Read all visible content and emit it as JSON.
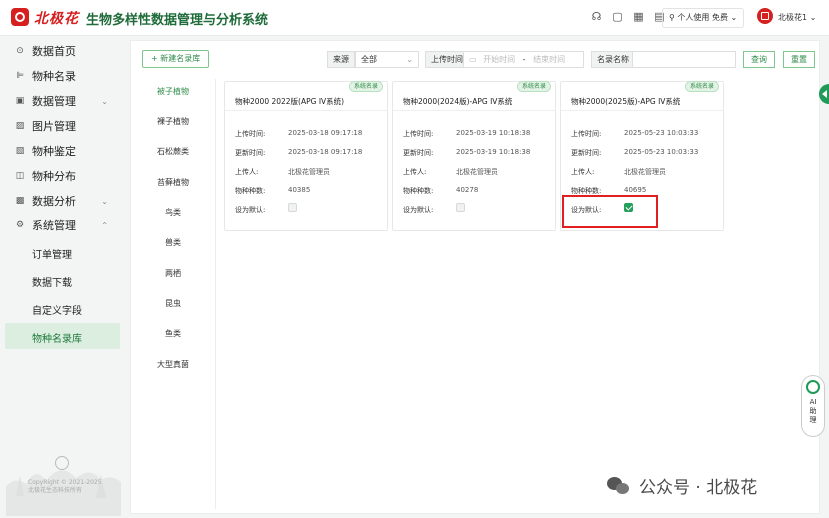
{
  "header": {
    "logo_text": "北极花",
    "app_title": "生物多样性数据管理与分析系统",
    "user_plan": "个人使用 免费",
    "user_name": "北极花1"
  },
  "sidebar": {
    "items": [
      {
        "label": "数据首页",
        "icon": "dashboard-icon"
      },
      {
        "label": "物种名录",
        "icon": "list-icon"
      },
      {
        "label": "数据管理",
        "icon": "folder-icon"
      },
      {
        "label": "图片管理",
        "icon": "image-icon"
      },
      {
        "label": "物种鉴定",
        "icon": "identify-icon"
      },
      {
        "label": "物种分布",
        "icon": "map-icon"
      },
      {
        "label": "数据分析",
        "icon": "chart-icon"
      },
      {
        "label": "系统管理",
        "icon": "settings-icon"
      }
    ],
    "sub_items": [
      "订单管理",
      "数据下载",
      "自定义字段",
      "物种名录库"
    ],
    "copyright": "CopyRight © 2021-2025",
    "copyright2": "北极花生态科技所有"
  },
  "toolbar": {
    "new_button": "+ 新建名录库",
    "source_label": "来源",
    "source_value": "全部",
    "upload_time_label": "上传时间",
    "start_placeholder": "开始时间",
    "end_placeholder": "结束时间",
    "dash": "-",
    "name_label": "名录名称",
    "query_button": "查询",
    "reset_button": "重置"
  },
  "categories": [
    "被子植物",
    "裸子植物",
    "石松蕨类",
    "苔藓植物",
    "鸟类",
    "兽类",
    "两栖",
    "昆虫",
    "鱼类",
    "大型真菌"
  ],
  "card_labels": {
    "upload_time": "上传时间:",
    "update_time": "更新时间:",
    "uploader": "上传人:",
    "species_count": "物种种数:",
    "set_default": "设为默认:"
  },
  "cards": [
    {
      "badge": "系统名录",
      "title": "物种2000 2022版(APG IV系统)",
      "upload_time": "2025-03-18 09:17:18",
      "update_time": "2025-03-18 09:17:18",
      "uploader": "北极花管理员",
      "species_count": "40385",
      "is_default": false
    },
    {
      "badge": "系统名录",
      "title": "物种2000(2024版)-APG IV系统",
      "upload_time": "2025-03-19 10:18:38",
      "update_time": "2025-03-19 10:18:38",
      "uploader": "北极花管理员",
      "species_count": "40278",
      "is_default": false
    },
    {
      "badge": "系统名录",
      "title": "物种2000(2025版)-APG IV系统",
      "upload_time": "2025-05-23 10:03:33",
      "update_time": "2025-05-23 10:03:33",
      "uploader": "北极花管理员",
      "species_count": "40695",
      "is_default": true
    }
  ],
  "ai_help": {
    "line1": "AI",
    "line2": "助",
    "line3": "理"
  },
  "watermark": "公众号 · 北极花",
  "colors": {
    "brand_red": "#d61f1f",
    "accent_green": "#2e8b4a",
    "highlight": "#e02020"
  }
}
